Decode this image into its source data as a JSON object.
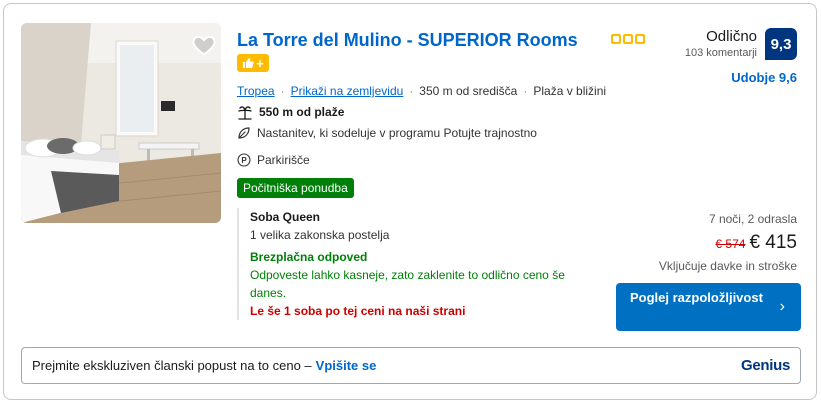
{
  "property": {
    "name": "La Torre del Mulino - SUPERIOR Rooms",
    "star_count": 3,
    "star_color": "#febb02",
    "location": {
      "town": "Tropea",
      "map_link": "Prikaži na zemljevidu",
      "distance_center": "350 m od središča",
      "beach_near": "Plaža v bližini"
    },
    "features": {
      "beach_distance": "550 m od plaže",
      "sustainability": "Nastanitev, ki sodeluje v programu Potujte trajnostno",
      "parking": "Parkirišče"
    },
    "deal_badge": "Počitniška ponudba"
  },
  "room": {
    "type": "Soba Queen",
    "bed": "1 velika zakonska postelja",
    "cancellation": "Brezplačna odpoved",
    "cancellation_note": "Odpoveste lahko kasneje, zato zaklenite to odlično ceno še danes.",
    "availability_warning": "Le še 1 soba po tej ceni na naši strani"
  },
  "review": {
    "word": "Odlično",
    "count": "103 komentarji",
    "score": "9,3",
    "comfort": "Udobje 9,6"
  },
  "pricing": {
    "stay": "7 noči, 2 odrasla",
    "old_price": "€ 574",
    "price": "€ 415",
    "taxes": "Vključuje davke in stroške",
    "button": "Poglej razpoložljivost"
  },
  "genius": {
    "text": "Prejmite ekskluziven članski popust na to ceno –",
    "link": "Vpišite se",
    "logo": "Genius"
  },
  "colors": {
    "link": "#0066cc",
    "score_bg": "#003580",
    "cta_bg": "#0071c2",
    "green": "#008009",
    "red": "#cc0000"
  }
}
